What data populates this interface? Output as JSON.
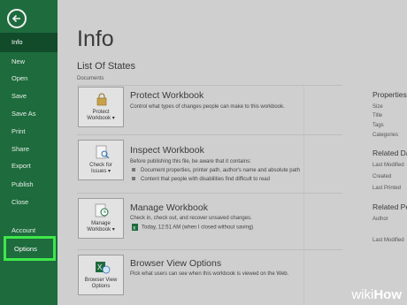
{
  "sidebar": {
    "items": [
      {
        "label": "Info"
      },
      {
        "label": "New"
      },
      {
        "label": "Open"
      },
      {
        "label": "Save"
      },
      {
        "label": "Save As"
      },
      {
        "label": "Print"
      },
      {
        "label": "Share"
      },
      {
        "label": "Export"
      },
      {
        "label": "Publish"
      },
      {
        "label": "Close"
      },
      {
        "label": "Account"
      },
      {
        "label": "Options"
      }
    ]
  },
  "main": {
    "title": "Info",
    "file_title": "List Of States",
    "file_path": "Documents",
    "sections": [
      {
        "title": "Protect Workbook",
        "button": "Protect\nWorkbook ▾",
        "desc": "Control what types of changes people can make to this workbook."
      },
      {
        "title": "Inspect Workbook",
        "button": "Check for\nIssues ▾",
        "desc": "Before publishing this file, be aware that it contains:",
        "bullets": [
          "Document properties, printer path, author's name and absolute path",
          "Content that people with disabilities find difficult to read"
        ]
      },
      {
        "title": "Manage Workbook",
        "button": "Manage\nWorkbook ▾",
        "desc": "Check in, check out, and recover unsaved changes.",
        "bullets": [
          "Today, 12:51 AM (when I closed without saving)"
        ]
      },
      {
        "title": "Browser View Options",
        "button": "Browser View\nOptions",
        "desc": "Pick what users can see when this workbook is viewed on the Web."
      }
    ]
  },
  "right": {
    "properties_heading": "Properties",
    "properties": [
      "Size",
      "Title",
      "Tags",
      "Categories"
    ],
    "related_dates_heading": "Related Da",
    "dates": [
      "Last Modified",
      "Created",
      "Last Printed"
    ],
    "related_people_heading": "Related Pe",
    "people": [
      "Author"
    ],
    "people2": [
      "Last Modified"
    ]
  },
  "watermark": {
    "w1": "wiki",
    "w2": "How"
  }
}
